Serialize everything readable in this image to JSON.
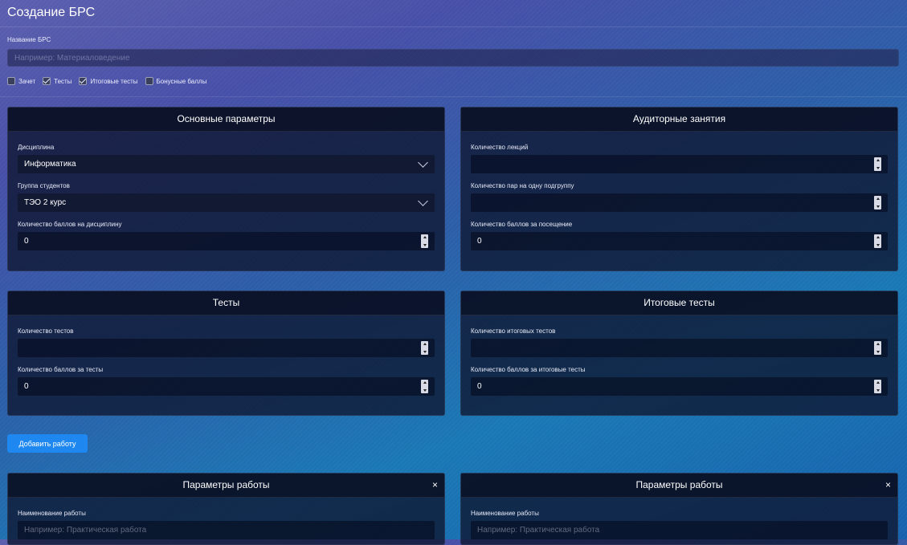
{
  "page": {
    "title": "Создание БРС"
  },
  "brs_name": {
    "label": "Название БРС",
    "placeholder": "Например: Материаловедение"
  },
  "options": [
    {
      "label": "Зачет",
      "checked": false
    },
    {
      "label": "Тесты",
      "checked": true
    },
    {
      "label": "Итоговые тесты",
      "checked": true
    },
    {
      "label": "Бонусные баллы",
      "checked": false
    }
  ],
  "basic": {
    "title": "Основные параметры",
    "discipline_label": "Дисциплина",
    "discipline_value": "Информатика",
    "group_label": "Группа студентов",
    "group_value": "ТЭО 2 курс",
    "points_label": "Количество баллов на дисциплину",
    "points_value": "0"
  },
  "classes": {
    "title": "Аудиторные занятия",
    "lectures_label": "Количество лекций",
    "lectures_value": "",
    "pairs_label": "Количество пар на одну подгруппу",
    "pairs_value": "",
    "attendance_label": "Количество баллов за посещение",
    "attendance_value": "0"
  },
  "tests": {
    "title": "Тесты",
    "count_label": "Количество тестов",
    "count_value": "",
    "points_label": "Количество баллов за тесты",
    "points_value": "0"
  },
  "final_tests": {
    "title": "Итоговые тесты",
    "count_label": "Количество итоговых тестов",
    "count_value": "",
    "points_label": "Количество баллов за итоговые тесты",
    "points_value": "0"
  },
  "add_work_button": "Добавить работу",
  "work_panels": [
    {
      "title": "Параметры работы",
      "close": "×",
      "name_label": "Наименование работы",
      "name_placeholder": "Например: Практическая работа"
    },
    {
      "title": "Параметры работы",
      "close": "×",
      "name_label": "Наименование работы",
      "name_placeholder": "Например: Практическая работа"
    }
  ],
  "colors": {
    "accent": "#1e88f0"
  }
}
